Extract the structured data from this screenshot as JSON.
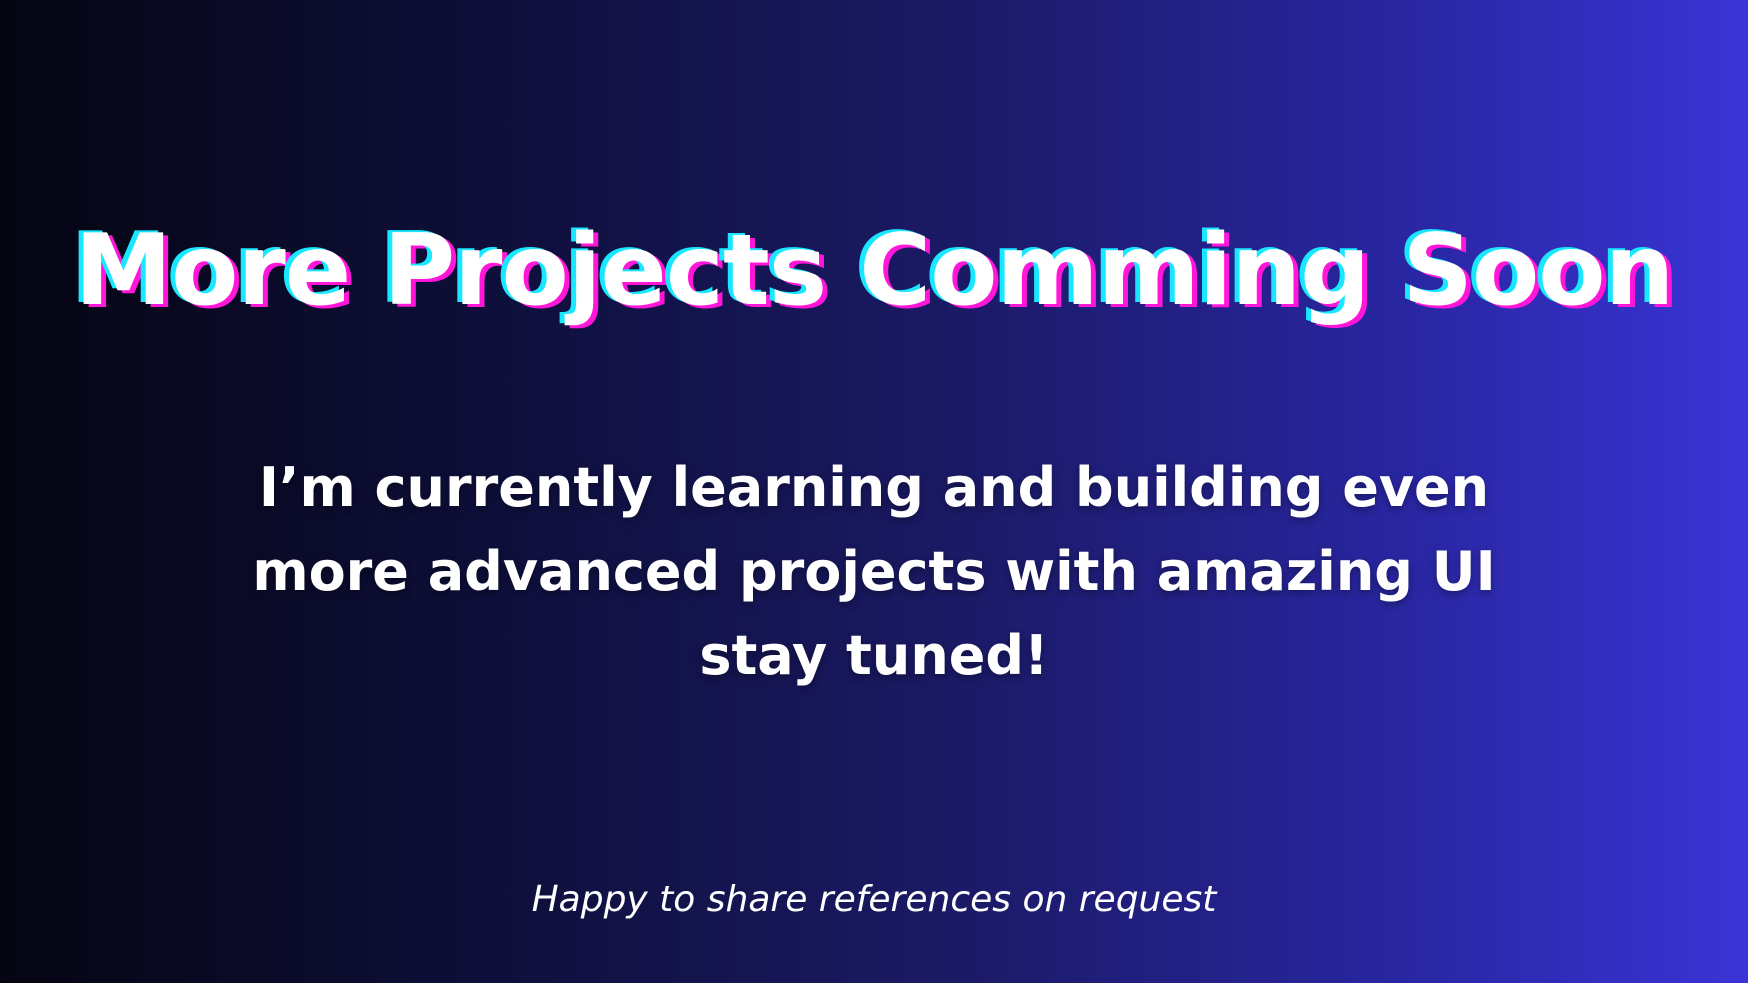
{
  "slide": {
    "headline": "More Projects Comming Soon",
    "message_lines": [
      "I’m currently learning and building even",
      "more advanced projects with amazing UI",
      "stay tuned!"
    ],
    "footer_note": "Happy to share references on request"
  },
  "colors": {
    "background_start": "#050512",
    "background_end": "#3a34d6",
    "headline_fill": "#ffffff",
    "headline_cyan_shadow": "#19e6ff",
    "headline_magenta_shadow": "#ff16d9",
    "text": "#ffffff"
  }
}
